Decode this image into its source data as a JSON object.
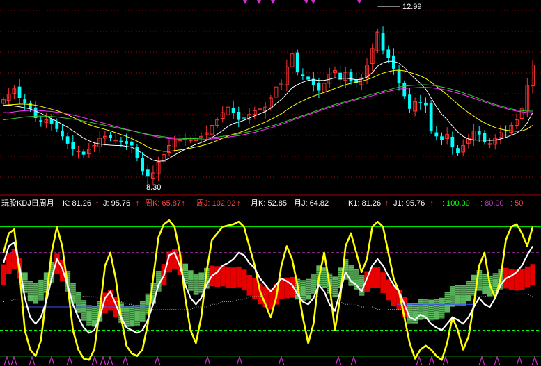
{
  "colors": {
    "up": "#ff3333",
    "down": "#00ffff",
    "ma_white": "#ffffff",
    "ma_yellow": "#ffff00",
    "ma_magenta": "#ff33ff",
    "ma_green": "#33cc33",
    "grid": "#b00000",
    "k_line": "#ffffff",
    "j_line": "#ffff00",
    "cloud_red": "#ff0000",
    "cloud_green": "#66cc66",
    "level_green": "#00ff00",
    "level_magenta": "#cc33cc",
    "marker": "#cc33cc",
    "label_white": "#ffffff",
    "label_red": "#ff4444",
    "label_green": "#00ff00"
  },
  "price_panel": {
    "high_label": "12.99",
    "low_label": "8.30"
  },
  "indicator_bar": {
    "title": "玩股KDJ日周月",
    "items": [
      {
        "label": "K: 81.26",
        "arrow": "↑",
        "color": "#ffffff"
      },
      {
        "label": "J: 95.76",
        "arrow": "↑",
        "color": "#ffffff"
      },
      {
        "label": "周K: 65.87",
        "arrow": "↑",
        "color": "#ff4444"
      },
      {
        "label": "周J: 102.92",
        "arrow": "↑",
        "color": "#ff4444"
      },
      {
        "label": "月K: 52.85",
        "arrow": "",
        "color": "#ffffff"
      },
      {
        "label": "月J: 64.82",
        "arrow": "",
        "color": "#ffffff"
      },
      {
        "label": "K1: 81.26",
        "arrow": "↑",
        "color": "#ffffff"
      },
      {
        "label": "J1: 95.76",
        "arrow": "↑",
        "color": "#ffffff"
      },
      {
        "label": ": 100.00",
        "arrow": "",
        "color": "#00ff00"
      },
      {
        "label": ": 80.00",
        "arrow": "",
        "color": "#cc33cc"
      },
      {
        "label": ": 50",
        "arrow": "",
        "color": "#ff4444"
      }
    ]
  },
  "chart_data": [
    {
      "type": "candlestick",
      "ylim": [
        8.0,
        13.2
      ],
      "series": [
        {
          "values": [
            10.55,
            10.7,
            10.85,
            10.6,
            10.45,
            10.3,
            10.05,
            9.95,
            10.0,
            9.9,
            9.75,
            9.55,
            9.35,
            9.2,
            9.15,
            9.05,
            9.2,
            9.3,
            9.5,
            9.55,
            9.5,
            9.45,
            9.4,
            9.35,
            9.3,
            8.95,
            8.6,
            8.45,
            8.55,
            8.85,
            9.05,
            9.3,
            9.45,
            9.45,
            9.5,
            9.45,
            9.5,
            9.55,
            9.65,
            9.85,
            10.0,
            10.2,
            10.35,
            10.2,
            10.0,
            10.05,
            10.15,
            10.25,
            10.3,
            10.35,
            10.6,
            10.9,
            11.0,
            11.45,
            11.8,
            11.3,
            11.2,
            11.1,
            10.95,
            10.8,
            11.0,
            11.25,
            11.35,
            11.1,
            11.3,
            11.05,
            11.0,
            11.15,
            11.5,
            11.95,
            12.4,
            11.9,
            11.7,
            11.4,
            11.0,
            10.65,
            10.3,
            10.5,
            10.45,
            10.4,
            9.7,
            9.55,
            9.45,
            9.6,
            9.25,
            9.1,
            9.3,
            9.5,
            9.7,
            9.6,
            9.4,
            9.35,
            9.5,
            9.65,
            9.7,
            9.85,
            10.0,
            10.3,
            10.95,
            11.5
          ]
        },
        {
          "values": [
            10.4,
            10.4,
            10.38,
            10.36,
            10.33,
            10.3,
            10.24,
            10.18,
            10.1,
            10.03,
            9.96,
            9.88,
            9.8,
            9.7,
            9.6,
            9.5,
            9.43,
            9.37,
            9.34,
            9.32,
            9.31,
            9.3,
            9.3,
            9.28,
            9.25,
            9.18,
            9.08,
            8.98,
            8.9,
            8.87,
            8.88,
            8.95,
            9.04,
            9.12,
            9.2,
            9.27,
            9.33,
            9.38,
            9.44,
            9.52,
            9.61,
            9.71,
            9.82,
            9.9,
            9.94,
            9.99,
            10.05,
            10.11,
            10.17,
            10.23,
            10.32,
            10.44,
            10.56,
            10.71,
            10.88,
            10.96,
            11.03,
            11.08,
            11.1,
            11.08,
            11.08,
            11.11,
            11.15,
            11.13,
            11.14,
            11.12,
            11.1,
            11.11,
            11.17,
            11.29,
            11.47,
            11.56,
            11.6,
            11.6,
            11.55,
            11.43,
            11.26,
            11.13,
            11.0,
            10.84,
            10.6,
            10.36,
            10.15,
            10.01,
            9.83,
            9.67,
            9.55,
            9.48,
            9.45,
            9.45,
            9.45,
            9.44,
            9.45,
            9.48,
            9.52,
            9.58,
            9.64,
            9.74,
            9.92,
            10.2
          ]
        },
        {
          "values": [
            10.4,
            10.41,
            10.42,
            10.43,
            10.43,
            10.42,
            10.4,
            10.37,
            10.33,
            10.29,
            10.25,
            10.2,
            10.14,
            10.07,
            10.0,
            9.93,
            9.87,
            9.82,
            9.78,
            9.74,
            9.7,
            9.65,
            9.6,
            9.55,
            9.49,
            9.42,
            9.34,
            9.26,
            9.2,
            9.16,
            9.14,
            9.14,
            9.16,
            9.18,
            9.2,
            9.23,
            9.26,
            9.29,
            9.33,
            9.38,
            9.44,
            9.5,
            9.56,
            9.61,
            9.65,
            9.7,
            9.76,
            9.82,
            9.88,
            9.94,
            10.01,
            10.09,
            10.17,
            10.27,
            10.37,
            10.45,
            10.52,
            10.59,
            10.65,
            10.7,
            10.75,
            10.8,
            10.86,
            10.91,
            10.96,
            11.0,
            11.03,
            11.06,
            11.1,
            11.15,
            11.22,
            11.28,
            11.32,
            11.35,
            11.36,
            11.34,
            11.3,
            11.25,
            11.2,
            11.13,
            11.03,
            10.92,
            10.8,
            10.69,
            10.56,
            10.43,
            10.31,
            10.2,
            10.1,
            10.0,
            9.92,
            9.85,
            9.79,
            9.75,
            9.72,
            9.7,
            9.69,
            9.7,
            9.75,
            9.85
          ]
        },
        {
          "values": [
            10.2,
            10.2,
            10.22,
            10.24,
            10.25,
            10.26,
            10.26,
            10.25,
            10.24,
            10.23,
            10.21,
            10.19,
            10.16,
            10.13,
            10.1,
            10.06,
            10.02,
            9.98,
            9.94,
            9.9,
            9.86,
            9.82,
            9.78,
            9.74,
            9.71,
            9.67,
            9.63,
            9.59,
            9.56,
            9.53,
            9.51,
            9.49,
            9.48,
            9.47,
            9.46,
            9.46,
            9.46,
            9.46,
            9.47,
            9.48,
            9.49,
            9.51,
            9.53,
            9.55,
            9.57,
            9.6,
            9.63,
            9.66,
            9.7,
            9.74,
            9.78,
            9.83,
            9.88,
            9.93,
            9.99,
            10.04,
            10.09,
            10.14,
            10.19,
            10.24,
            10.29,
            10.34,
            10.38,
            10.43,
            10.47,
            10.51,
            10.55,
            10.58,
            10.62,
            10.66,
            10.7,
            10.74,
            10.78,
            10.81,
            10.84,
            10.86,
            10.87,
            10.88,
            10.89,
            10.89,
            10.88,
            10.86,
            10.84,
            10.81,
            10.77,
            10.73,
            10.69,
            10.64,
            10.59,
            10.54,
            10.49,
            10.44,
            10.39,
            10.35,
            10.31,
            10.27,
            10.24,
            10.22,
            10.2,
            10.2
          ]
        },
        {
          "values": [
            10.0,
            10.02,
            10.04,
            10.06,
            10.08,
            10.09,
            10.1,
            10.1,
            10.1,
            10.09,
            10.08,
            10.06,
            10.04,
            10.02,
            10.0,
            9.97,
            9.94,
            9.91,
            9.88,
            9.85,
            9.82,
            9.79,
            9.76,
            9.73,
            9.7,
            9.67,
            9.64,
            9.61,
            9.58,
            9.56,
            9.54,
            9.52,
            9.51,
            9.5,
            9.49,
            9.49,
            9.49,
            9.5,
            9.51,
            9.52,
            9.53,
            9.55,
            9.57,
            9.59,
            9.62,
            9.65,
            9.68,
            9.71,
            9.75,
            9.79,
            9.83,
            9.87,
            9.92,
            9.97,
            10.02,
            10.07,
            10.12,
            10.17,
            10.22,
            10.27,
            10.32,
            10.37,
            10.42,
            10.46,
            10.5,
            10.54,
            10.58,
            10.62,
            10.66,
            10.7,
            10.74,
            10.78,
            10.82,
            10.86,
            10.9,
            10.92,
            10.94,
            10.95,
            10.96,
            10.96,
            10.95,
            10.93,
            10.9,
            10.87,
            10.83,
            10.79,
            10.74,
            10.69,
            10.64,
            10.58,
            10.52,
            10.47,
            10.42,
            10.38,
            10.34,
            10.3,
            10.27,
            10.25,
            10.24,
            10.24
          ]
        }
      ]
    },
    {
      "type": "line",
      "ylim": [
        -5,
        110
      ],
      "series": [
        {
          "values": [
            72,
            85,
            88,
            70,
            45,
            30,
            25,
            30,
            42,
            60,
            75,
            68,
            55,
            40,
            30,
            22,
            18,
            20,
            30,
            45,
            50,
            40,
            30,
            22,
            20,
            18,
            20,
            28,
            40,
            55,
            62,
            78,
            80,
            70,
            55,
            45,
            40,
            45,
            55,
            62,
            65,
            70,
            72,
            75,
            80,
            78,
            72,
            68,
            60,
            55,
            50,
            55,
            60,
            58,
            55,
            48,
            42,
            40,
            45,
            55,
            50,
            40,
            35,
            50,
            65,
            58,
            55,
            50,
            60,
            70,
            75,
            70,
            62,
            55,
            50,
            40,
            30,
            28,
            32,
            30,
            25,
            22,
            20,
            25,
            30,
            28,
            25,
            30,
            38,
            45,
            40,
            38,
            45,
            55,
            60,
            62,
            65,
            70,
            78,
            85
          ]
        },
        {
          "values": [
            80,
            95,
            98,
            65,
            20,
            5,
            0,
            12,
            45,
            80,
            100,
            85,
            55,
            20,
            5,
            -2,
            -3,
            5,
            35,
            70,
            80,
            60,
            30,
            8,
            2,
            0,
            5,
            25,
            60,
            92,
            102,
            105,
            100,
            80,
            45,
            20,
            10,
            30,
            65,
            90,
            95,
            100,
            101,
            102,
            104,
            100,
            85,
            70,
            50,
            40,
            30,
            45,
            70,
            85,
            75,
            55,
            30,
            10,
            25,
            60,
            80,
            55,
            20,
            45,
            85,
            95,
            80,
            65,
            75,
            100,
            104,
            100,
            80,
            60,
            50,
            30,
            10,
            -2,
            5,
            8,
            5,
            0,
            -3,
            10,
            30,
            20,
            5,
            15,
            40,
            70,
            80,
            55,
            45,
            60,
            90,
            100,
            102,
            95,
            85,
            100
          ]
        }
      ]
    }
  ]
}
